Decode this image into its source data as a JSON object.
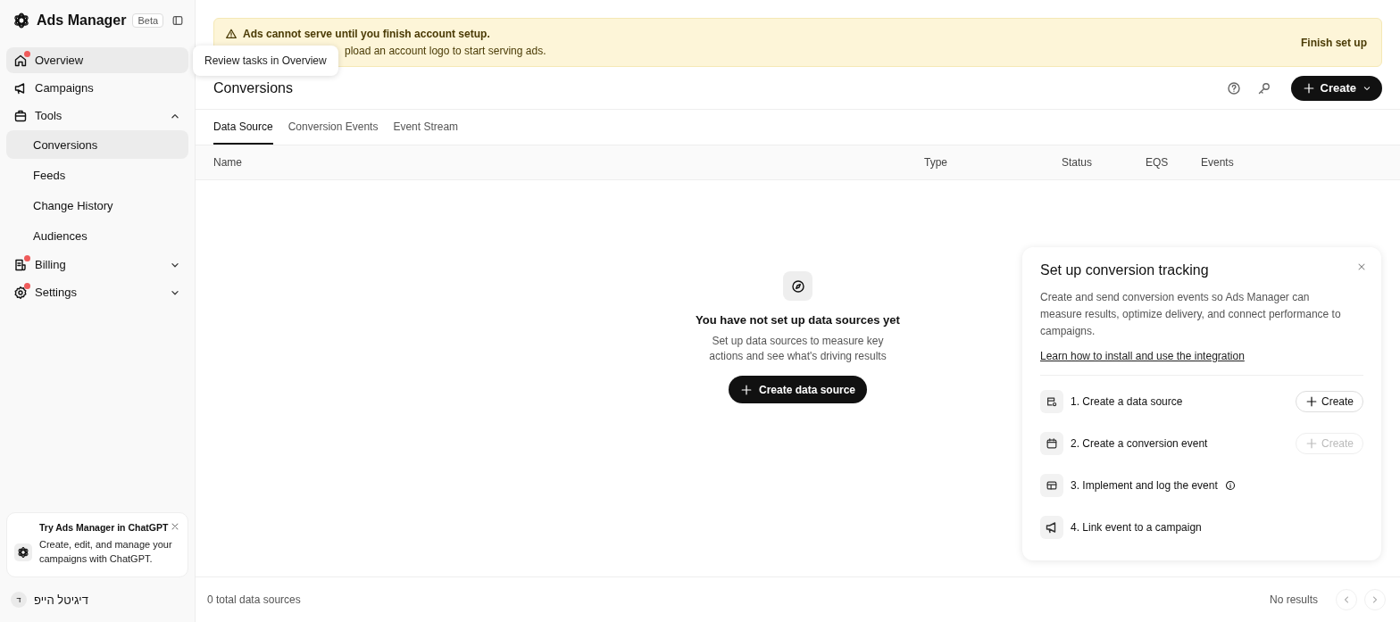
{
  "app": {
    "title": "Ads Manager",
    "badge": "Beta"
  },
  "nav": [
    {
      "label": "Overview",
      "dot": true,
      "hovered": true
    },
    {
      "label": "Campaigns",
      "dot": false,
      "hovered": false
    },
    {
      "label": "Tools",
      "dot": false,
      "hovered": false,
      "expanded": true,
      "children": [
        {
          "label": "Conversions",
          "selected": true
        },
        {
          "label": "Feeds",
          "selected": false
        },
        {
          "label": "Change History",
          "selected": false
        },
        {
          "label": "Audiences",
          "selected": false
        }
      ]
    },
    {
      "label": "Billing",
      "dot": true,
      "hovered": false,
      "expanded": false
    },
    {
      "label": "Settings",
      "dot": true,
      "hovered": false,
      "expanded": false
    }
  ],
  "promo": {
    "title": "Try Ads Manager in ChatGPT",
    "text": "Create, edit, and manage your campaigns with ChatGPT."
  },
  "user": {
    "initial": "ד",
    "name": "דיגיטל הייפ"
  },
  "tooltip": "Review tasks in Overview",
  "banner": {
    "title": "Ads cannot serve until you finish account setup.",
    "text": "pload an account logo to start serving ads.",
    "action": "Finish set up"
  },
  "page": {
    "title": "Conversions",
    "create": "Create"
  },
  "tabs": [
    {
      "label": "Data Source",
      "selected": true
    },
    {
      "label": "Conversion Events",
      "selected": false
    },
    {
      "label": "Event Stream",
      "selected": false
    }
  ],
  "table": {
    "columns": [
      "Name",
      "Type",
      "Status",
      "EQS",
      "Events"
    ]
  },
  "empty": {
    "title": "You have not set up data sources yet",
    "text": "Set up data sources to measure key actions and see what's driving results",
    "button": "Create data source"
  },
  "setup": {
    "title": "Set up conversion tracking",
    "text": "Create and send conversion events so Ads Manager can measure results, optimize delivery, and connect performance to campaigns.",
    "link": "Learn how to install and use the integration",
    "steps": [
      {
        "label": "1. Create a data source",
        "info": false,
        "button": "Create",
        "disabled": false
      },
      {
        "label": "2. Create a conversion event",
        "info": false,
        "button": "Create",
        "disabled": true
      },
      {
        "label": "3. Implement and log the event",
        "info": true
      },
      {
        "label": "4. Link event to a campaign",
        "info": false
      }
    ]
  },
  "footer": {
    "count": "0 total data sources",
    "results": "No results"
  }
}
